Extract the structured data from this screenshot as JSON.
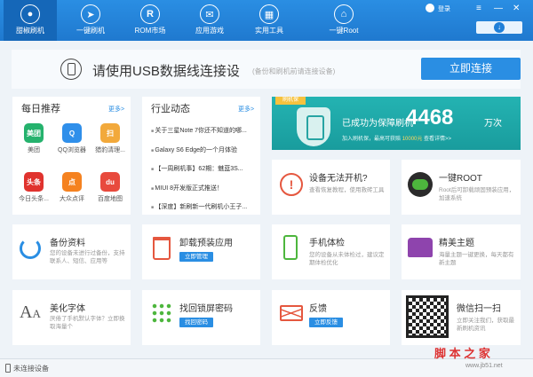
{
  "nav": {
    "items": [
      {
        "label": "甜椒刷机",
        "icon": "logo-icon"
      },
      {
        "label": "一键刷机",
        "icon": "cursor-icon"
      },
      {
        "label": "ROM市场",
        "icon": "rom-icon"
      },
      {
        "label": "应用游戏",
        "icon": "mail-icon"
      },
      {
        "label": "实用工具",
        "icon": "grid-icon"
      },
      {
        "label": "一键Root",
        "icon": "car-icon"
      }
    ],
    "login": "登录"
  },
  "connect": {
    "text": "请使用USB数据线连接设",
    "subtext": "(备份和刷机前请连接设备)",
    "button": "立即连接"
  },
  "recommend": {
    "title": "每日推荐",
    "more": "更多>",
    "apps": [
      {
        "label": "美团",
        "badge": "美团",
        "color": "#25b26d"
      },
      {
        "label": "QQ浏览器",
        "badge": "Q",
        "color": "#2f8fea"
      },
      {
        "label": "猎豹清理...",
        "badge": "扫",
        "color": "#f2a93b"
      },
      {
        "label": "今日头条...",
        "badge": "头条",
        "color": "#e0332e"
      },
      {
        "label": "大众点评",
        "badge": "点",
        "color": "#f58220"
      },
      {
        "label": "百度地图",
        "badge": "du",
        "color": "#e84a3d"
      }
    ]
  },
  "news": {
    "title": "行业动态",
    "more": "更多>",
    "items": [
      "关于三星Note 7你还不知道的哪...",
      "Galaxy S6 Edge的一个月体验",
      "【一周刷机事】62期：魅蓝3S...",
      "MIUI 8开发版正式推送！",
      "【深度】新刷新一代刷机小王子..."
    ]
  },
  "stat": {
    "ribbon": "刷机保",
    "line1": "已成功为保障刷机",
    "number": "4468",
    "unit": "万次",
    "line2a": "加入刷机保，最高可获赔",
    "line2b": "10000元",
    "line2c": "查看详情>>"
  },
  "features": {
    "cannot_boot": {
      "title": "设备无法开机?",
      "desc": "查看恢复教程，使用救砖工具"
    },
    "root": {
      "title": "一键ROOT",
      "desc": "Root后可卸载顽固预装应用，加速系统"
    },
    "backup": {
      "title": "备份资料",
      "desc": "您的设备未进行过备份，支持联系人、短信、应用等"
    },
    "uninstall": {
      "title": "卸载预装应用",
      "button": "立即管理"
    },
    "check": {
      "title": "手机体检",
      "desc": "您的设备从未体检过，建议定期体检优化"
    },
    "theme": {
      "title": "精美主题",
      "desc": "海量主题一键更换，每天都有新主题"
    },
    "font": {
      "title": "美化字体",
      "desc": "厌倦了手机默认字体？立即换取海量个"
    },
    "unlock": {
      "title": "找回锁屏密码",
      "button": "找回密码"
    },
    "feedback": {
      "title": "反馈",
      "button": "立即反馈"
    },
    "wechat": {
      "title": "微信扫一扫",
      "desc": "立即关注我们，获取最新刷机资讯"
    }
  },
  "status": {
    "text": "未连接设备"
  },
  "watermark": {
    "text": "脚 本 之 家",
    "sub": "www.jb51.net"
  }
}
